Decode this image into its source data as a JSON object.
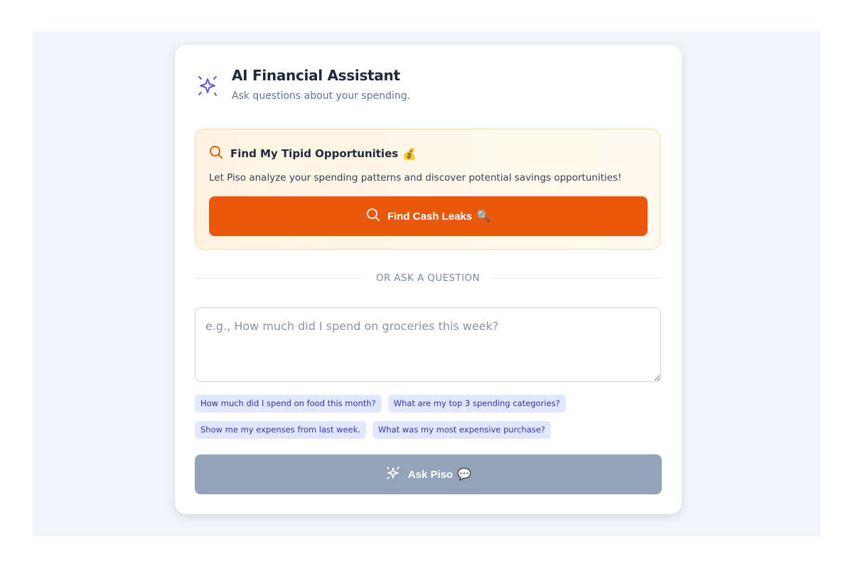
{
  "header": {
    "title": "AI Financial Assistant",
    "subtitle": "Ask questions about your spending.",
    "icon": "sparkles-icon",
    "icon_color": "#5b5bd6"
  },
  "tipid": {
    "title": "Find My Tipid Opportunities",
    "title_emoji": "💰",
    "description": "Let Piso analyze your spending patterns and discover potential savings opportunities!",
    "button_label": "Find Cash Leaks",
    "button_emoji": "🔍",
    "accent": "#ea580c",
    "icon": "search-icon"
  },
  "divider": {
    "label": "OR ASK A QUESTION"
  },
  "question": {
    "value": "",
    "placeholder": "e.g., How much did I spend on groceries this week?"
  },
  "suggestions": [
    "How much did I spend on food this month?",
    "What are my top 3 spending categories?",
    "Show me my expenses from last week.",
    "What was my most expensive purchase?"
  ],
  "ask": {
    "label": "Ask Piso",
    "emoji": "💬",
    "disabled_color": "#94a3b8",
    "icon": "sparkles-icon"
  }
}
